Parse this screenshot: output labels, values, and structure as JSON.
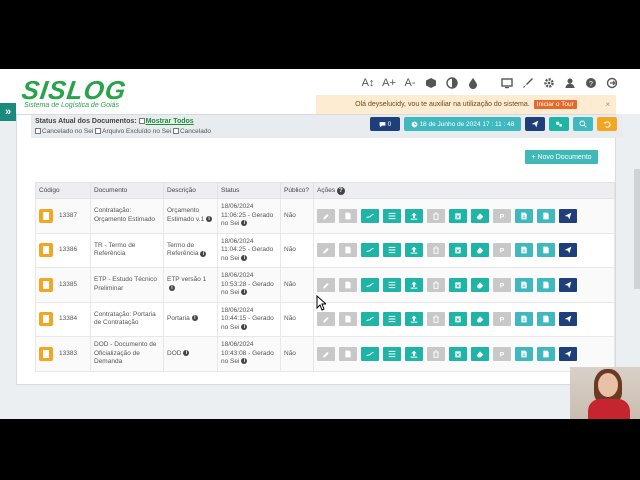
{
  "app": {
    "logo_text": "SISLOG",
    "logo_subtitle": "Sistema de Logística de Goiás"
  },
  "toolbar": {
    "icons": [
      "font-size-reset-icon",
      "font-increase-icon",
      "font-decrease-icon",
      "cube-icon",
      "contrast-icon",
      "drop-icon",
      "monitor-icon",
      "brush-icon",
      "gear-icon",
      "user-icon",
      "help-icon",
      "logout-icon"
    ],
    "font_reset": "A↕",
    "font_increase": "A+",
    "font_decrease": "A-"
  },
  "notice": {
    "text": "Olá deyselucidy, vou te auxiliar na utilização do sistema.",
    "button": "Iniciar o Tour",
    "close": "×"
  },
  "status": {
    "title": "Status Atual dos Documentos:",
    "show_all": "Mostrar Todos",
    "options": [
      "Cancelado no Sei",
      "Arquivo Excluído no Sei",
      "Cancelado"
    ],
    "comments_count": "0",
    "datetime": "18 de Junho de 2024 17 : 11 : 48"
  },
  "new_document_label": "+ Novo Documento",
  "table": {
    "headers": [
      "Código",
      "Documento",
      "Descrição",
      "Status",
      "Público?",
      "Ações"
    ],
    "rows": [
      {
        "code": "13387",
        "documento": "Contratação: Orçamento Estimado",
        "descricao": "Orçamento Estimado v.1",
        "status": "18/06/2024 11:06:25 - Gerado no Sei",
        "publico": "Não"
      },
      {
        "code": "13386",
        "documento": "TR - Termo de Referência",
        "descricao": "Termo de Referência",
        "status": "18/06/2024 11:04:25 - Gerado no Sei",
        "publico": "Não"
      },
      {
        "code": "13385",
        "documento": "ETP - Estudo Técnico Preliminar",
        "descricao": "ETP versão 1",
        "status": "18/06/2024 10:53:28 - Gerado no Sei",
        "publico": "Não"
      },
      {
        "code": "13384",
        "documento": "Contratação: Portaria de Contratação",
        "descricao": "Portaria",
        "status": "18/06/2024 10:44:15 - Gerado no Sei",
        "publico": "Não"
      },
      {
        "code": "13383",
        "documento": "DOD - Documento de Oficialização de Demanda",
        "descricao": "DOD",
        "status": "18/06/2024 10:43:08 - Gerado no Sei",
        "publico": "Não"
      }
    ],
    "action_buttons": [
      {
        "name": "edit-icon",
        "color": "#c8c8c8"
      },
      {
        "name": "document-icon",
        "color": "#c8c8c8"
      },
      {
        "name": "signature-icon",
        "color": "#1fb5a6"
      },
      {
        "name": "list-icon",
        "color": "#1fb5a6"
      },
      {
        "name": "upload-icon",
        "color": "#1fb5a6"
      },
      {
        "name": "trash-icon",
        "color": "#c8c8c8"
      },
      {
        "name": "archive-delete-icon",
        "color": "#1fb5a6"
      },
      {
        "name": "eraser-icon",
        "color": "#1fb5a6"
      },
      {
        "name": "p-icon",
        "color": "#c8c8c8"
      },
      {
        "name": "pdf-icon",
        "color": "#3fb8c0"
      },
      {
        "name": "file-icon",
        "color": "#3fb8c0"
      },
      {
        "name": "send-icon",
        "color": "#1e3f7a"
      }
    ]
  }
}
